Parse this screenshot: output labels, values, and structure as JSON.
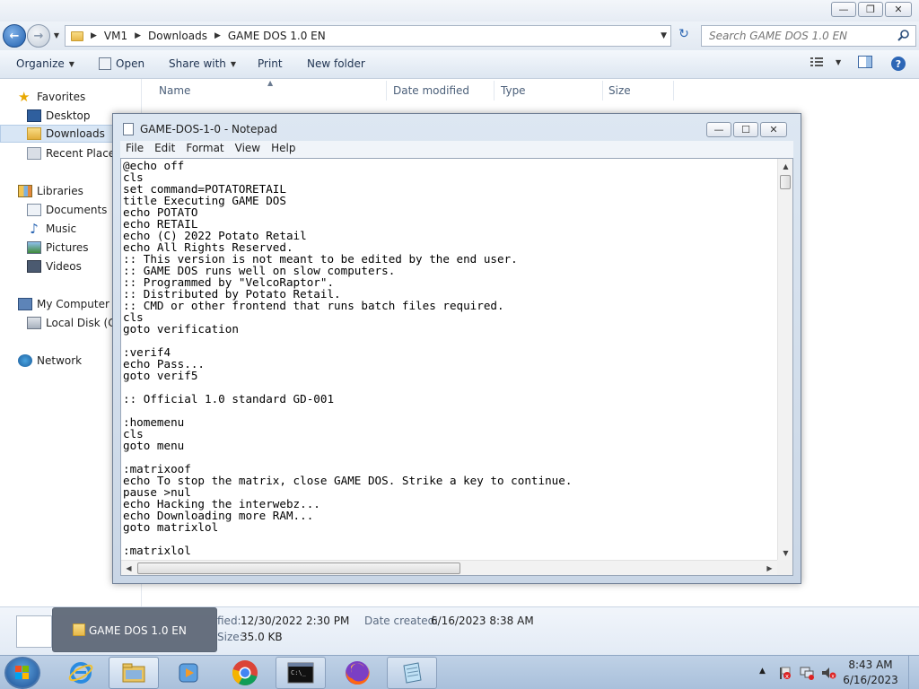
{
  "explorer": {
    "breadcrumb": [
      "VM1",
      "Downloads",
      "GAME DOS 1.0 EN"
    ],
    "search_placeholder": "Search GAME DOS 1.0 EN",
    "toolbar": {
      "organize": "Organize",
      "open": "Open",
      "share_with": "Share with",
      "print": "Print",
      "new_folder": "New folder"
    },
    "nav": {
      "favorites": "Favorites",
      "desktop": "Desktop",
      "downloads": "Downloads",
      "recent_places": "Recent Places",
      "libraries": "Libraries",
      "documents": "Documents",
      "music": "Music",
      "pictures": "Pictures",
      "videos": "Videos",
      "my_computer": "My Computer",
      "local_disk": "Local Disk (C:)",
      "network": "Network"
    },
    "columns": {
      "name": "Name",
      "date_modified": "Date modified",
      "type": "Type",
      "size": "Size"
    },
    "details": {
      "modified_label": "fied:",
      "modified_value": "12/30/2022 2:30 PM",
      "created_label": "Date created:",
      "created_value": "6/16/2023 8:38 AM",
      "size_label": "Size:",
      "size_value": "35.0 KB"
    }
  },
  "notepad": {
    "title": "GAME-DOS-1-0 - Notepad",
    "menu": [
      "File",
      "Edit",
      "Format",
      "View",
      "Help"
    ],
    "lines": [
      "@echo off",
      "cls",
      "set command=POTATORETAIL",
      "title Executing GAME DOS",
      "echo POTATO",
      "echo RETAIL",
      "echo (C) 2022 Potato Retail",
      "echo All Rights Reserved.",
      ":: This version is not meant to be edited by the end user.",
      ":: GAME DOS runs well on slow computers.",
      ":: Programmed by \"VelcoRaptor\".",
      ":: Distributed by Potato Retail.",
      ":: CMD or other frontend that runs batch files required.",
      "cls",
      "goto verification",
      "",
      ":verif4",
      "echo Pass...",
      "goto verif5",
      "",
      ":: Official 1.0 standard GD-001",
      "",
      ":homemenu",
      "cls",
      "goto menu",
      "",
      ":matrixoof",
      "echo To stop the matrix, close GAME DOS. Strike a key to continue.",
      "pause >nul",
      "echo Hacking the interwebz...",
      "echo Downloading more RAM...",
      "goto matrixlol",
      "",
      ":matrixlol"
    ]
  },
  "taskbar": {
    "preview_label": "GAME DOS 1.0 EN",
    "time": "8:43 AM",
    "date": "6/16/2023",
    "icons": [
      "start-orb",
      "internet-explorer",
      "windows-explorer",
      "media-player",
      "chrome",
      "command-prompt",
      "firefox",
      "notepad"
    ]
  },
  "colors": {
    "taskbar": "#aac1dc",
    "selection": "#d8e6f5",
    "link_blue": "#1e3250"
  }
}
